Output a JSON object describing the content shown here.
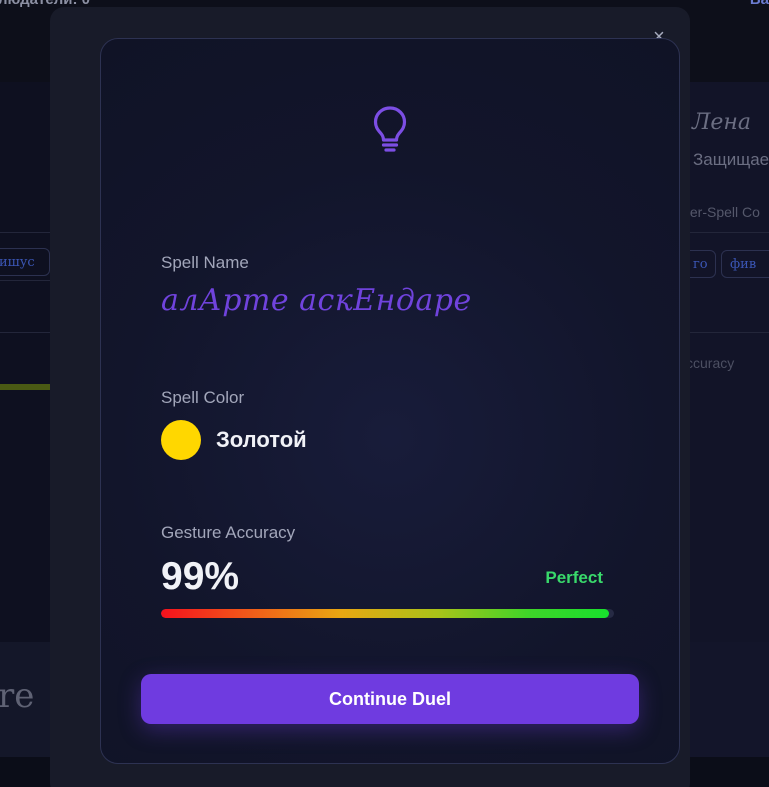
{
  "background": {
    "top_left_text": "людатели: 0",
    "top_right_text": "Ва",
    "left_chip_text": "ишус",
    "left_bottom_text": "re",
    "right_player_name": "Лена",
    "right_player_status": "Защищае",
    "right_mode_text": "ter-Spell Co",
    "right_chip_1": "го",
    "right_chip_2": "фив",
    "right_accuracy_label": "ccuracy"
  },
  "modal": {
    "close_label": "×",
    "icon": "lightbulb-icon",
    "spell_name_label": "Spell Name",
    "spell_name_value": "алАрте аскЕндаре",
    "spell_color_label": "Spell Color",
    "spell_color_value": "Золотой",
    "spell_color_hex": "#ffd700",
    "gesture_accuracy_label": "Gesture Accuracy",
    "gesture_accuracy_value": "99%",
    "gesture_accuracy_fraction": 0.99,
    "gesture_rating": "Perfect",
    "continue_button_label": "Continue Duel"
  },
  "colors": {
    "accent": "#6f3be0",
    "icon": "#7c4ee4",
    "rating": "#39d96b"
  }
}
